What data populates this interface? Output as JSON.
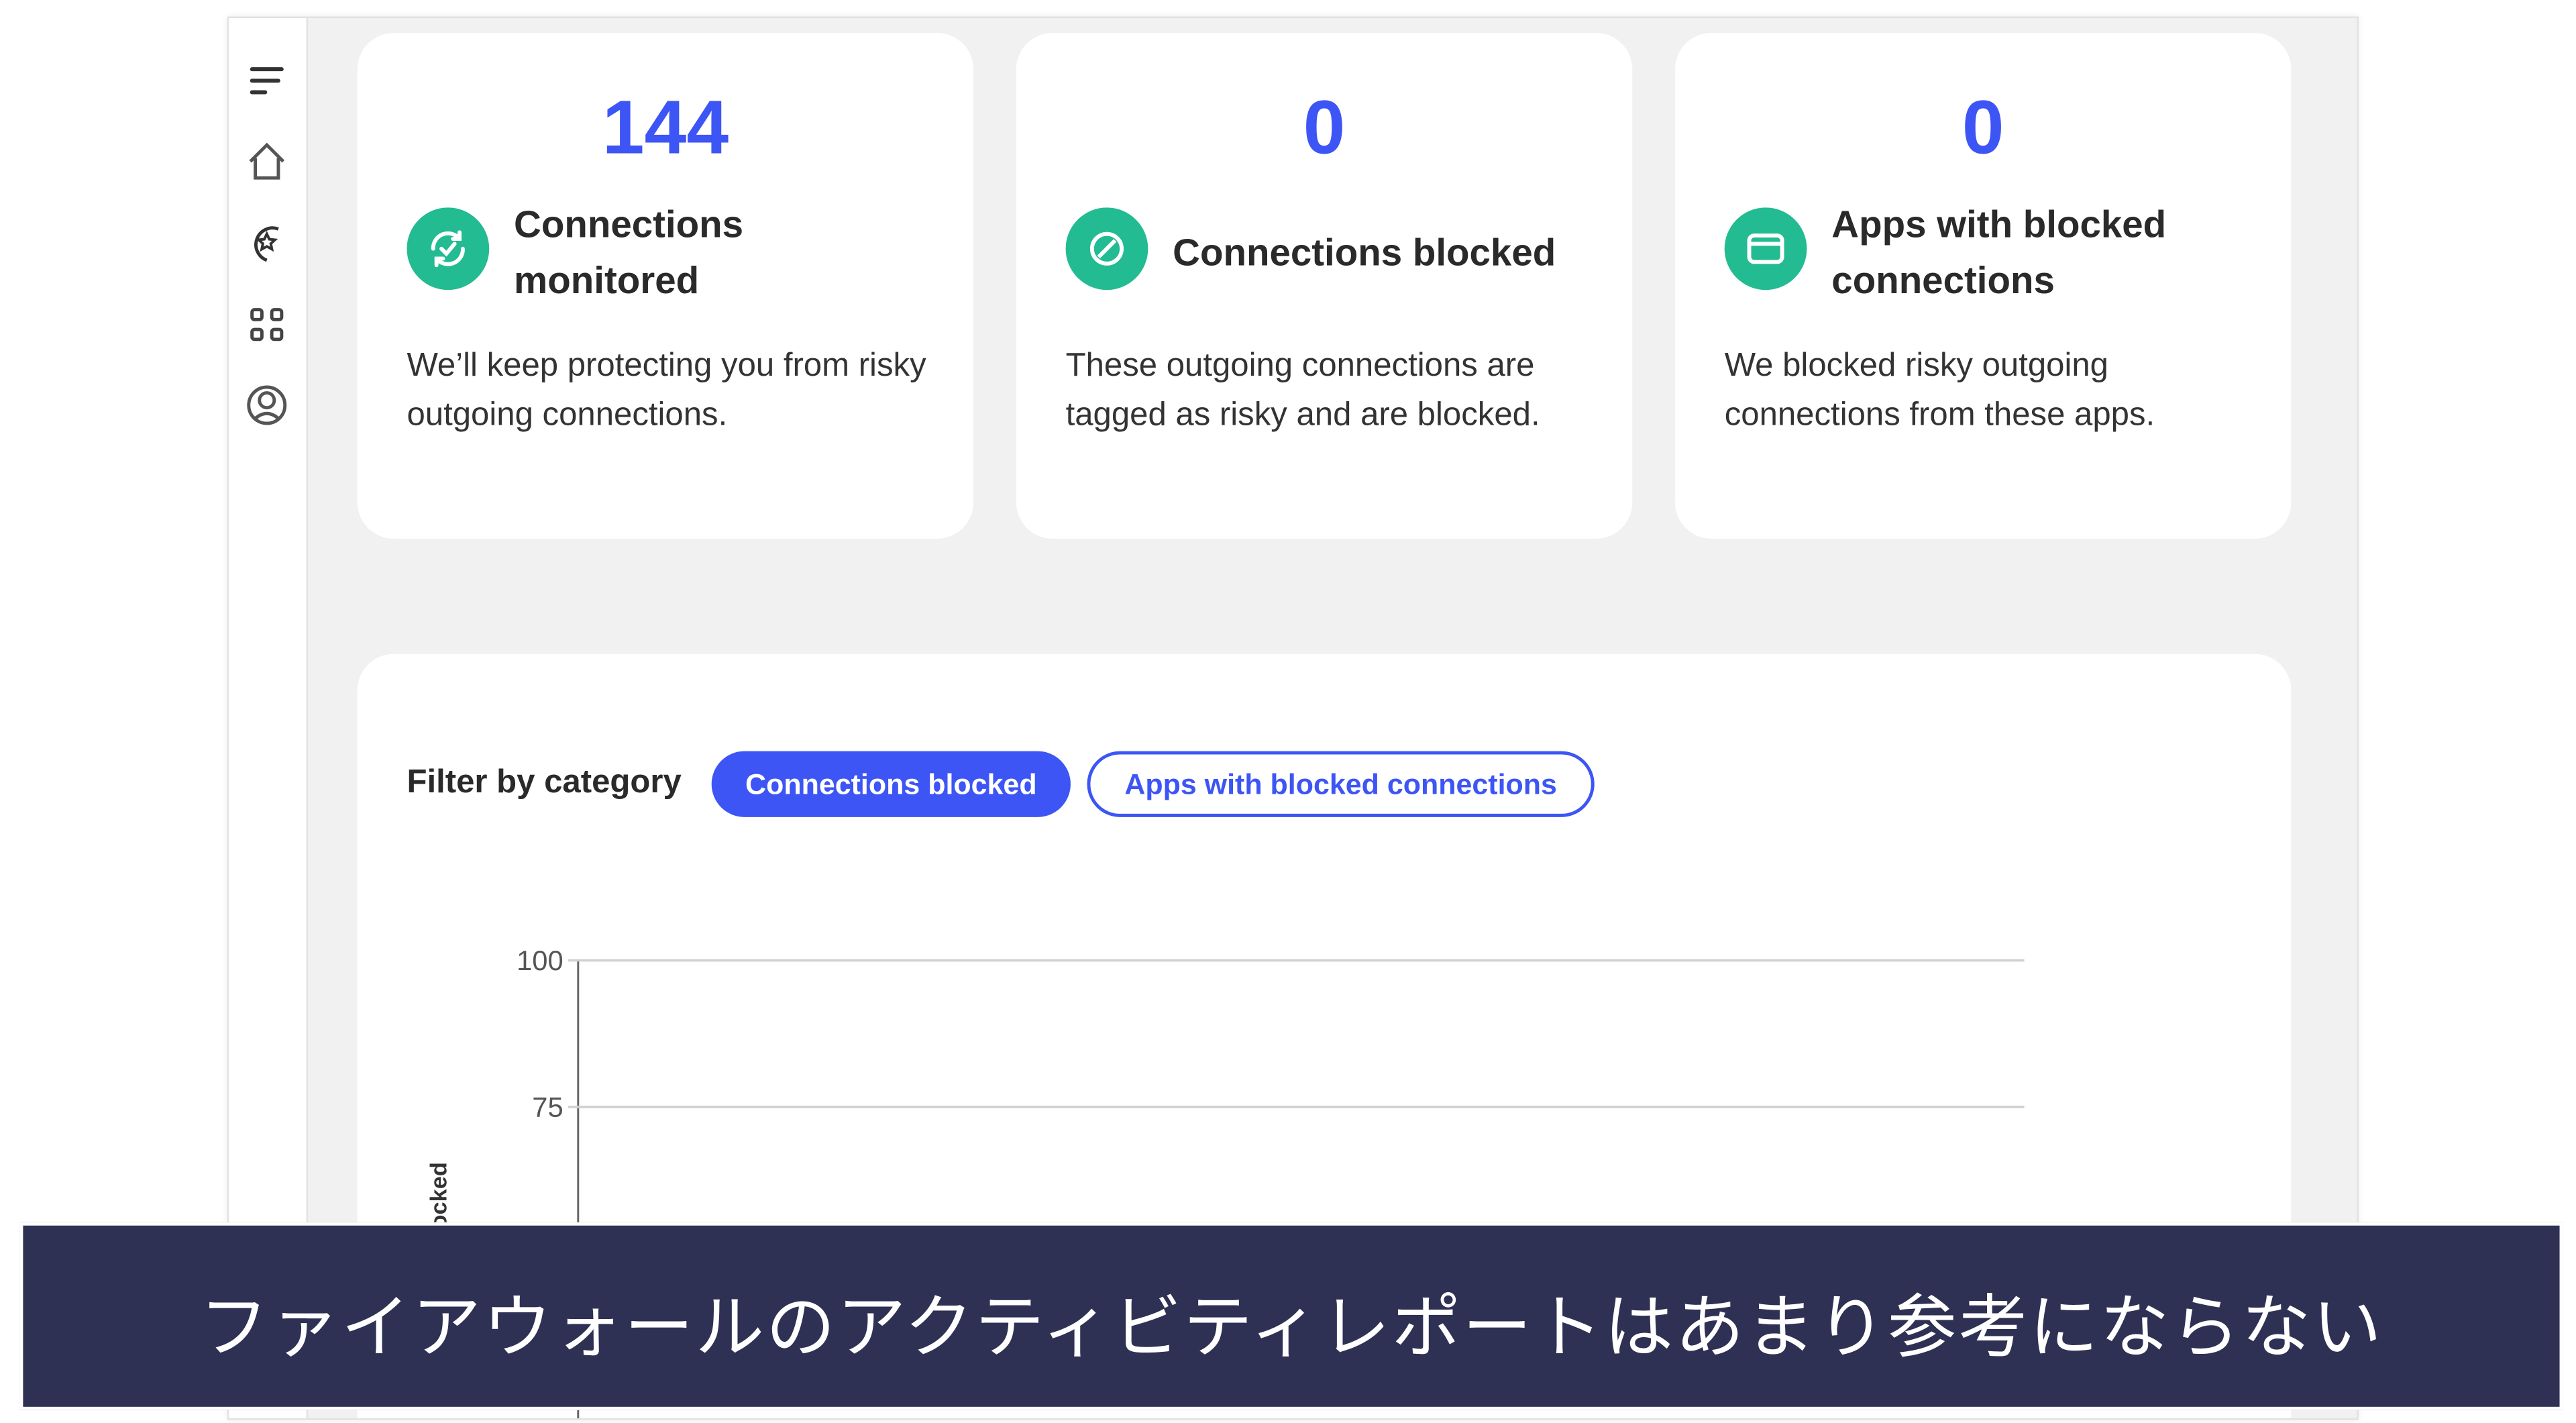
{
  "sidebar": {
    "items": [
      {
        "icon": "menu-icon"
      },
      {
        "icon": "home-icon"
      },
      {
        "icon": "protection-star-icon"
      },
      {
        "icon": "apps-grid-icon"
      },
      {
        "icon": "account-icon"
      }
    ]
  },
  "cards": [
    {
      "value": "144",
      "title_line1": "Connections",
      "title_line2": "monitored",
      "description": "We’ll keep protecting you from risky outgoing connections.",
      "icon": "sync-check-icon"
    },
    {
      "value": "0",
      "title_line1": "Connections blocked",
      "title_line2": "",
      "description": "These outgoing connections are tagged as risky and are blocked.",
      "icon": "blocked-icon"
    },
    {
      "value": "0",
      "title_line1": "Apps with blocked",
      "title_line2": "connections",
      "description": "We blocked risky outgoing connections from these apps.",
      "icon": "app-window-icon"
    }
  ],
  "filter": {
    "label": "Filter by category",
    "options": [
      "Connections blocked",
      "Apps with blocked connections"
    ],
    "selected": "Connections blocked"
  },
  "colors": {
    "accent": "#3d55f5",
    "icon_green": "#23bb91",
    "banner": "#2e3054"
  },
  "chart_data": {
    "type": "line",
    "ylabel": "Connections blocked",
    "yticks": [
      "100",
      "75"
    ],
    "ylim": [
      0,
      100
    ],
    "grid": true,
    "series": []
  },
  "caption": "ファイアウォールのアクティビティレポートはあまり参考にならない"
}
